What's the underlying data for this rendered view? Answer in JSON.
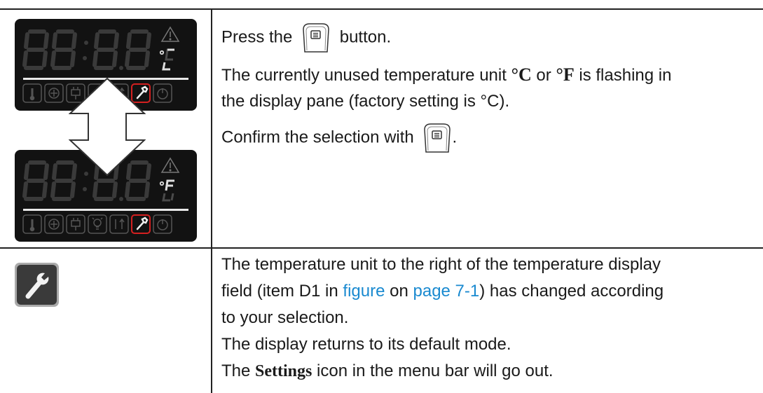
{
  "row1": {
    "line1_pre": "Press the",
    "line1_post": "button.",
    "line2_pre": "The currently unused temperature unit",
    "unit_c": "°C",
    "line2_mid": "or",
    "unit_f": "°F",
    "line2_post": "is flashing in",
    "line3": "the display pane (factory setting is °C).",
    "line4_pre": "Confirm the selection with",
    "line4_post": "."
  },
  "row2": {
    "line1": "The temperature unit to the right of the temperature display",
    "line2_pre": "field (item D1 in",
    "link_figure": "figure",
    "line2_mid": "on",
    "link_page": "page 7-1",
    "line2_post": ") has changed according",
    "line3": "to your selection.",
    "line4": "The display returns to its default mode.",
    "line5_pre": "The",
    "settings_word": "Settings",
    "line5_post": "icon in the menu bar will go out."
  },
  "display_top": {
    "digits": "88:8.8",
    "unit": "°C",
    "warning_icon": "warning-triangle-icon"
  },
  "display_bottom": {
    "digits": "88:8.8",
    "unit": "°F",
    "warning_icon": "warning-triangle-icon"
  },
  "menu_icons": [
    "thermometer-icon",
    "fan-icon",
    "plug-icon",
    "lamp-icon",
    "temperature-up-icon",
    "wrench-icon",
    "power-icon"
  ],
  "colors": {
    "display_bg": "#121212",
    "digit_off": "#3a3a3a",
    "active_icon": "#d42020",
    "link": "#1a8ad0"
  }
}
